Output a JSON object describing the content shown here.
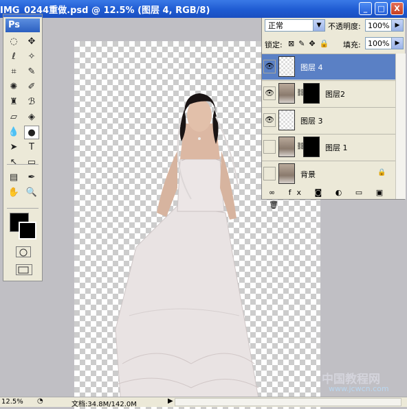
{
  "window": {
    "title": "IMG_0244重做.psd @ 12.5% (图层 4, RGB/8)",
    "min_label": "_",
    "max_label": "□",
    "close_label": "X"
  },
  "toolbox": {
    "logo": "Ps",
    "tools": [
      {
        "name": "marquee-tool",
        "glyph": "◌"
      },
      {
        "name": "move-tool",
        "glyph": "✥"
      },
      {
        "name": "lasso-tool",
        "glyph": "ℓ"
      },
      {
        "name": "magic-wand-tool",
        "glyph": "✧"
      },
      {
        "name": "crop-tool",
        "glyph": "⌗"
      },
      {
        "name": "slice-tool",
        "glyph": "✎"
      },
      {
        "name": "healing-tool",
        "glyph": "✺"
      },
      {
        "name": "brush-tool",
        "glyph": "✐"
      },
      {
        "name": "stamp-tool",
        "glyph": "♜"
      },
      {
        "name": "history-brush-tool",
        "glyph": "ℬ"
      },
      {
        "name": "eraser-tool",
        "glyph": "▱"
      },
      {
        "name": "paint-bucket-tool",
        "glyph": "◈"
      },
      {
        "name": "blur-tool",
        "glyph": "💧"
      },
      {
        "name": "dodge-tool",
        "glyph": "●"
      },
      {
        "name": "path-select-tool",
        "glyph": "➤"
      },
      {
        "name": "type-tool",
        "glyph": "T"
      },
      {
        "name": "direct-select-tool",
        "glyph": "↖"
      },
      {
        "name": "shape-tool",
        "glyph": "▭"
      },
      {
        "name": "notes-tool",
        "glyph": "▤"
      },
      {
        "name": "eyedropper-tool",
        "glyph": "✒"
      },
      {
        "name": "hand-tool",
        "glyph": "✋"
      },
      {
        "name": "zoom-tool",
        "glyph": "🔍"
      }
    ],
    "active_tool": "dodge-tool",
    "foreground_color": "#000000",
    "background_color": "#000000"
  },
  "layers_panel": {
    "blend_mode": "正常",
    "opacity_label": "不透明度:",
    "opacity_value": "100%",
    "lock_label": "锁定:",
    "lock_icons": "⊠✎✥🔒",
    "fill_label": "填充:",
    "fill_value": "100%",
    "layers": [
      {
        "name": "图层 4",
        "visible": true,
        "selected": true,
        "thumb": "checker",
        "mask": false,
        "locked": false
      },
      {
        "name": "图层2",
        "visible": true,
        "selected": false,
        "thumb": "photo",
        "mask": true,
        "locked": false
      },
      {
        "name": "图层 3",
        "visible": true,
        "selected": false,
        "thumb": "checker",
        "mask": false,
        "locked": false
      },
      {
        "name": "图层 1",
        "visible": false,
        "selected": false,
        "thumb": "photo",
        "mask": true,
        "locked": false
      },
      {
        "name": "背景",
        "visible": false,
        "selected": false,
        "thumb": "photo",
        "mask": false,
        "locked": true
      }
    ],
    "bottom_icons": "∞ fx ◙ ◐ ▭ ▣ 🗑"
  },
  "status_bar": {
    "zoom": "12.5%",
    "doc_info": "文档:34.8M/142.0M"
  },
  "watermark": {
    "text": "中国教程网",
    "url": "www.jcwcn.com"
  }
}
